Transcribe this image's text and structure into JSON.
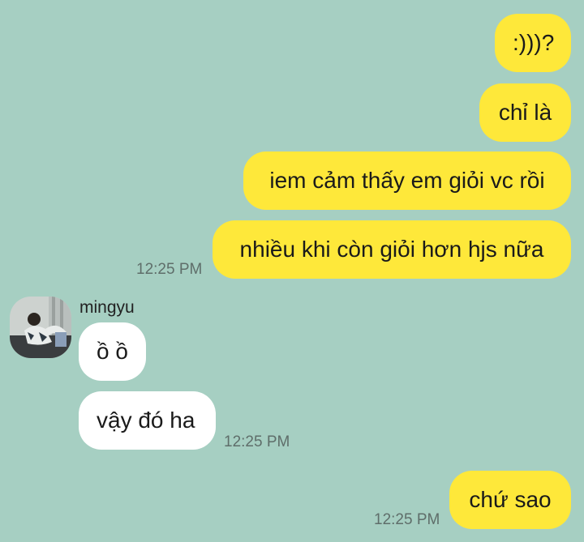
{
  "chat": {
    "sender_name": "mingyu",
    "messages": [
      {
        "text": ":)))?",
        "direction": "out"
      },
      {
        "text": "chỉ là",
        "direction": "out"
      },
      {
        "text": "iem cảm thấy em giỏi vc rồi",
        "direction": "out"
      },
      {
        "text": "nhiều khi còn giỏi hơn hjs nữa",
        "direction": "out",
        "time": "12:25 PM"
      },
      {
        "text": "ồ ồ",
        "direction": "in"
      },
      {
        "text": "vậy đó ha",
        "direction": "in",
        "time": "12:25 PM"
      },
      {
        "text": "chứ sao",
        "direction": "out",
        "time": "12:25 PM"
      }
    ]
  },
  "colors": {
    "background": "#a6cfc2",
    "outgoing_bubble": "#fee83a",
    "incoming_bubble": "#ffffff",
    "timestamp": "#5f6e6a"
  },
  "icons": {
    "avatar": "profile-photo-icon"
  }
}
